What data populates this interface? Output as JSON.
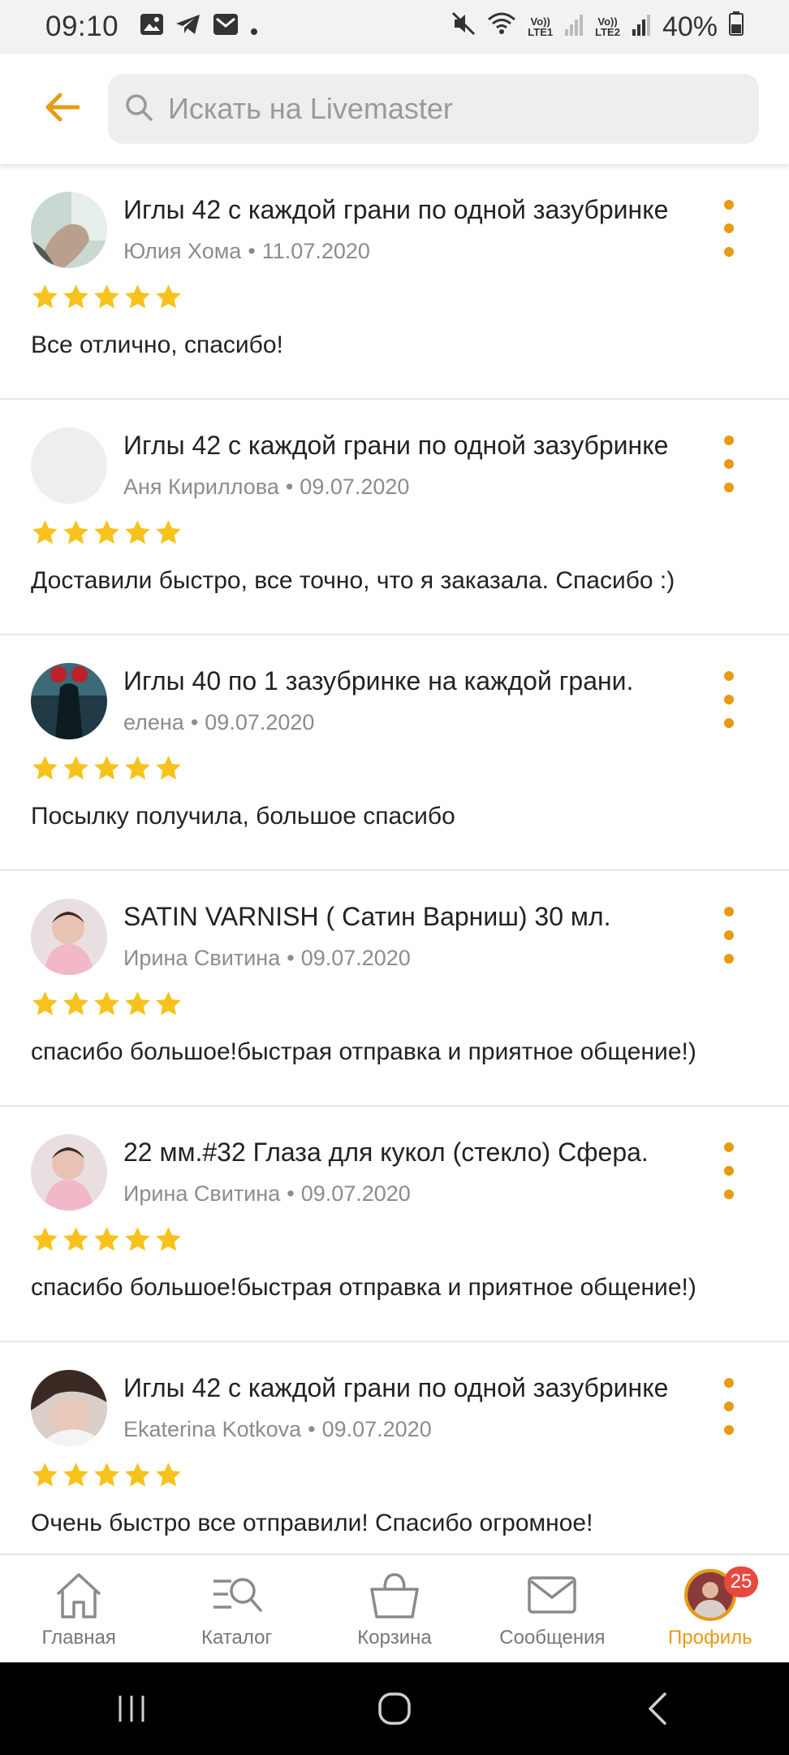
{
  "status_bar": {
    "time": "09:10",
    "net1": [
      "Vo))",
      "LTE1"
    ],
    "net2": [
      "Vo))",
      "LTE2"
    ],
    "battery": "40%"
  },
  "search": {
    "placeholder": "Искать на Livemaster"
  },
  "reviews": [
    {
      "title": "Иглы 42 с каждой грани по одной зазубринке",
      "author": "Юлия Хома",
      "date": "11.07.2020",
      "rating": 5,
      "text": "Все отлично, спасибо!"
    },
    {
      "title": "Иглы 42 с каждой грани по одной зазубринке",
      "author": "Аня Кириллова",
      "date": "09.07.2020",
      "rating": 5,
      "text": "Доставили быстро, все точно, что я заказала. Спасибо :)"
    },
    {
      "title": "Иглы 40 по 1 зазубринке на каждой грани.",
      "author": "елена",
      "date": "09.07.2020",
      "rating": 5,
      "text": "Посылку получила, большое спасибо"
    },
    {
      "title": "SATIN VARNISH ( Сатин Варниш) 30 мл.",
      "author": "Ирина Свитина",
      "date": "09.07.2020",
      "rating": 5,
      "text": "спасибо большое!быстрая отправка и приятное общение!)"
    },
    {
      "title": "22 мм.#32 Глаза для кукол (стекло) Сфера.",
      "author": "Ирина Свитина",
      "date": "09.07.2020",
      "rating": 5,
      "text": "спасибо большое!быстрая отправка и приятное общение!)"
    },
    {
      "title": "Иглы 42 с каждой грани по одной зазубринке",
      "author": "Ekaterina Kotkova",
      "date": "09.07.2020",
      "rating": 5,
      "text": "Очень быстро все отправили! Спасибо огромное!"
    }
  ],
  "bottom_nav": {
    "items": [
      {
        "label": "Главная",
        "icon": "home-icon"
      },
      {
        "label": "Каталог",
        "icon": "catalog-icon"
      },
      {
        "label": "Корзина",
        "icon": "basket-icon"
      },
      {
        "label": "Сообщения",
        "icon": "envelope-icon"
      },
      {
        "label": "Профиль",
        "icon": "profile-avatar"
      }
    ],
    "badge": "25",
    "active": "Профиль"
  },
  "colors": {
    "accent": "#e89a14",
    "star": "#f7c21b",
    "badge": "#e8493f"
  }
}
